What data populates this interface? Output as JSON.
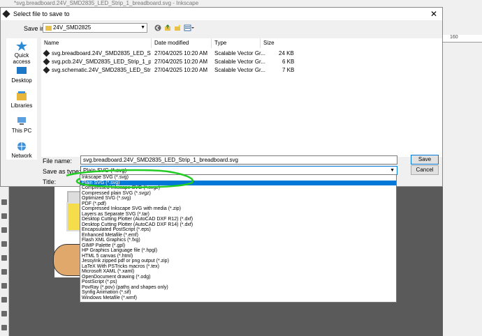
{
  "background": {
    "window_title": "*svg.breadboard.24V_SMD2835_LED_Strip_1_breadboard.svg - Inkscape",
    "ruler_label": "160"
  },
  "dialog": {
    "title": "Select file to save to",
    "close_glyph": "✕",
    "save_in_label": "Save in:",
    "save_in_value": "24V_SMD2825",
    "places": [
      {
        "label": "Quick access",
        "icon": "star-icon"
      },
      {
        "label": "Desktop",
        "icon": "desktop-icon"
      },
      {
        "label": "Libraries",
        "icon": "libraries-icon"
      },
      {
        "label": "This PC",
        "icon": "computer-icon"
      },
      {
        "label": "Network",
        "icon": "network-icon"
      }
    ],
    "columns": [
      "Name",
      "Date modified",
      "Type",
      "Size"
    ],
    "files": [
      {
        "name": "svg.breadboard.24V_SMD2835_LED_Strip_1_...",
        "date": "27/04/2025 10:20 AM",
        "type": "Scalable Vector Gr...",
        "size": "24 KB"
      },
      {
        "name": "svg.pcb.24V_SMD2835_LED_Strip_1_pcb.svg",
        "date": "27/04/2025 10:20 AM",
        "type": "Scalable Vector Gr...",
        "size": "6 KB"
      },
      {
        "name": "svg.schematic.24V_SMD2835_LED_Strip_1_sc...",
        "date": "27/04/2025 10:20 AM",
        "type": "Scalable Vector Gr...",
        "size": "7 KB"
      }
    ],
    "file_name_label": "File name:",
    "file_name_value": "svg.breadboard.24V_SMD2835_LED_Strip_1_breadboard.svg",
    "save_type_label": "Save as type:",
    "save_type_value": "Plain SVG (*.svg)",
    "title_label": "Title:",
    "save_button": "Save",
    "cancel_button": "Cancel",
    "type_options": [
      "Inkscape SVG (*.svg)",
      "Plain SVG (*.svg)",
      "Compressed Inkscape SVG (*.svgz)",
      "Compressed plain SVG (*.svgz)",
      "Optimized SVG (*.svg)",
      "PDF (*.pdf)",
      "Compressed Inkscape SVG with media (*.zip)",
      "Layers as Separate SVG (*.tar)",
      "Desktop Cutting Plotter (AutoCAD DXF R12) (*.dxf)",
      "Desktop Cutting Plotter (AutoCAD DXF R14) (*.dxf)",
      "Encapsulated PostScript (*.eps)",
      "Enhanced Metafile (*.emf)",
      "Flash XML Graphics (*.fxg)",
      "GIMP Palette (*.gpl)",
      "HP Graphics Language file (*.hpgl)",
      "HTML 5 canvas (*.html)",
      "JessyInk zipped pdf or png output (*.zip)",
      "LaTeX With PSTricks macros (*.tex)",
      "Microsoft XAML (*.xaml)",
      "OpenDocument drawing (*.odg)",
      "PostScript (*.ps)",
      "PovRay (*.pov) (paths and shapes only)",
      "Synfig Animation (*.sif)",
      "Windows Metafile (*.wmf)"
    ],
    "selected_option_index": 1
  },
  "colors": {
    "selection": "#0078d7",
    "annotation": "#22cc22"
  }
}
